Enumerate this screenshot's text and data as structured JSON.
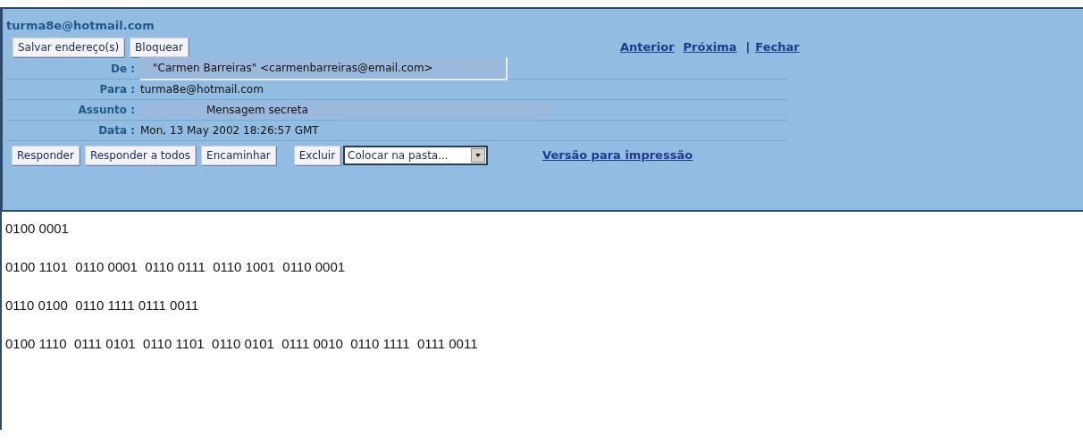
{
  "account": "turma8e@hotmail.com",
  "top_buttons": [
    "Salvar endereço(s)",
    "Bloquear"
  ],
  "nav_links": [
    {
      "label": "Anterior"
    },
    {
      "label": "Próxima"
    },
    {
      "label": "|",
      "kind": "separator"
    },
    {
      "label": "Fechar"
    }
  ],
  "fields": [
    {
      "label": "De :",
      "value": "\"Carmen Barreiras\" <carmenbarreiras@email.com>",
      "kind": "boxed"
    },
    {
      "label": "Para :",
      "value": "turma8e@hotmail.com",
      "kind": "plain"
    },
    {
      "label": "Assunto :",
      "value": "Mensagem secreta",
      "kind": "indented"
    },
    {
      "label": "Data :",
      "value": "Mon, 13 May 2002 18:26:57 GMT",
      "kind": "plain"
    }
  ],
  "action_buttons": [
    "Responder",
    "Responder a todos",
    "Encaminhar",
    "Excluir"
  ],
  "folder_select": {
    "value": "Colocar na pasta..."
  },
  "print_link": "Versão para impressão",
  "body_lines": [
    "0100 0001",
    "0100 1101  0110 0001  0110 0111  0110 1001  0110 0001",
    "0110 0100  0110 1111 0111 0011",
    "0100 1110  0111 0101  0110 1101  0110 0101  0111 0010  0110 1111  0111 0011"
  ]
}
